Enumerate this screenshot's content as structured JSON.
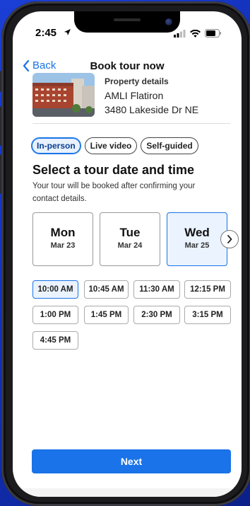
{
  "status": {
    "time": "2:45"
  },
  "nav": {
    "back_label": "Back",
    "title": "Book tour now"
  },
  "property": {
    "label": "Property details",
    "name": "AMLI Flatiron",
    "address": "3480 Lakeside Dr NE"
  },
  "tour_types": [
    {
      "label": "In-person",
      "selected": true
    },
    {
      "label": "Live video",
      "selected": false
    },
    {
      "label": "Self-guided",
      "selected": false
    }
  ],
  "section": {
    "title": "Select a tour date and time",
    "subtitle": "Your tour will be booked after confirming your contact details."
  },
  "dates": [
    {
      "day": "Mon",
      "date": "Mar 23",
      "selected": false
    },
    {
      "day": "Tue",
      "date": "Mar 24",
      "selected": false
    },
    {
      "day": "Wed",
      "date": "Mar 25",
      "selected": true
    }
  ],
  "times": [
    {
      "label": "10:00 AM",
      "selected": true
    },
    {
      "label": "10:45 AM",
      "selected": false
    },
    {
      "label": "11:30 AM",
      "selected": false
    },
    {
      "label": "12:15 PM",
      "selected": false
    },
    {
      "label": "1:00 PM",
      "selected": false
    },
    {
      "label": "1:45 PM",
      "selected": false
    },
    {
      "label": "2:30 PM",
      "selected": false
    },
    {
      "label": "3:15 PM",
      "selected": false
    },
    {
      "label": "4:45 PM",
      "selected": false
    }
  ],
  "next_label": "Next",
  "colors": {
    "accent": "#1a73e8",
    "background": "#1b3fd6"
  }
}
